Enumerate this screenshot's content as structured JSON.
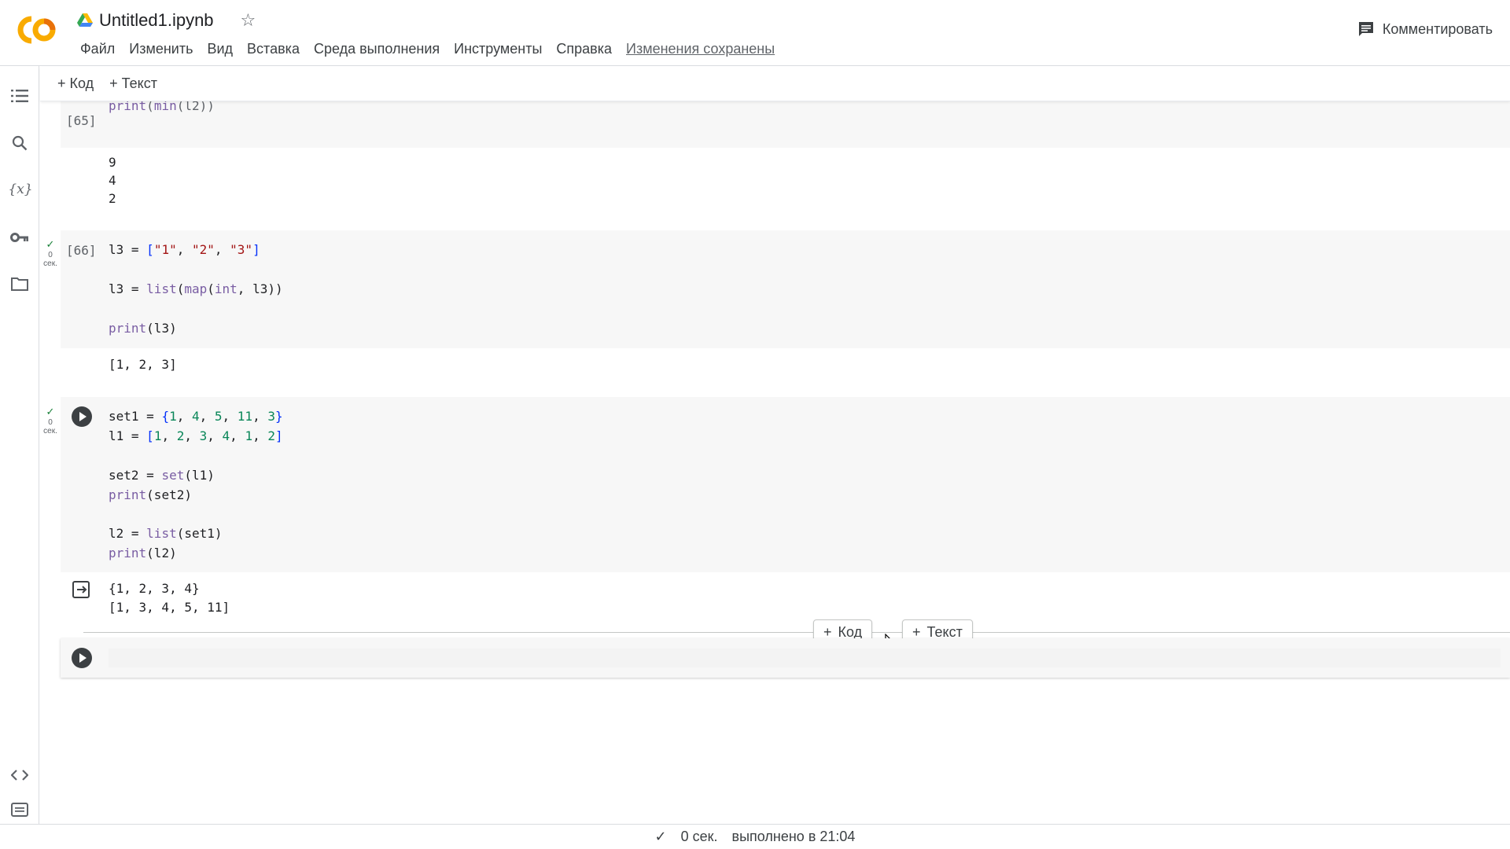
{
  "app": {
    "logo_text": "CO",
    "notebook_title": "Untitled1.ipynb",
    "menu": [
      "Файл",
      "Изменить",
      "Вид",
      "Вставка",
      "Среда выполнения",
      "Инструменты",
      "Справка"
    ],
    "saved_status": "Изменения сохранены",
    "comment_label": "Комментировать"
  },
  "toolbar": {
    "add_code": "+ Код",
    "add_text": "+ Текст"
  },
  "cells": {
    "c65": {
      "count": "[65]",
      "code_tail": "print(min(l2))",
      "output": [
        "9",
        "4",
        "2"
      ]
    },
    "c66": {
      "count": "[66]",
      "status_time": "0",
      "status_unit": "сек.",
      "code": [
        "l3 = [\"1\", \"2\", \"3\"]",
        "l3 = list(map(int, l3))",
        "print(l3)"
      ],
      "output": "[1, 2, 3]"
    },
    "c67": {
      "status_time": "0",
      "status_unit": "сек.",
      "code": [
        "set1 = {1, 4, 5, 11, 3}",
        "l1 = [1, 2, 3, 4, 1, 2]",
        "set2 = set(l1)",
        "print(set2)",
        "l2 = list(set1)",
        "print(l2)"
      ],
      "output": [
        "{1, 2, 3, 4}",
        "[1, 3, 4, 5, 11]"
      ]
    }
  },
  "insert_bar": {
    "code_label": "Код",
    "text_label": "Текст"
  },
  "footer": {
    "duration": "0 сек.",
    "completed": "выполнено в 21:04"
  },
  "colors": {
    "logo_orange": "#f9ab00",
    "logo_dark_orange": "#e8710a",
    "run_button": "#3c4043",
    "cell_background": "#f7f7f7"
  },
  "icons": [
    "menu-list-icon",
    "search-icon",
    "variables-icon",
    "key-icon",
    "folder-icon",
    "code-snippets-icon",
    "terminal-icon",
    "comment-icon",
    "star-icon",
    "drive-icon"
  ]
}
